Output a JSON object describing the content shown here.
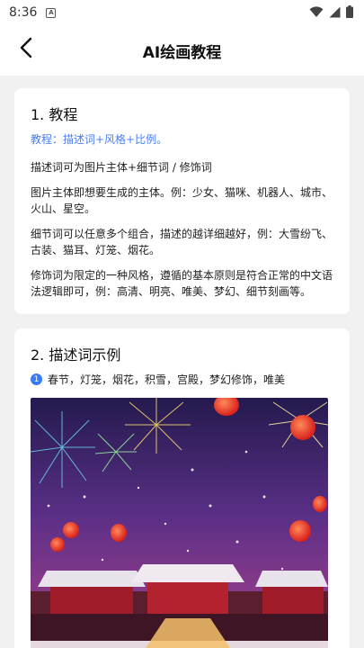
{
  "status_bar": {
    "time": "8:36",
    "app_icon_letter": "A",
    "icons": [
      "wifi-icon",
      "signal-icon",
      "battery-icon"
    ]
  },
  "header": {
    "title": "AI绘画教程",
    "back_icon": "back-arrow-icon"
  },
  "tutorial": {
    "heading": "1. 教程",
    "subtitle": "教程：描述词+风格+比例。",
    "paragraphs": [
      "描述词可为图片主体+细节词 / 修饰词",
      "图片主体即想要生成的主体。例：少女、猫咪、机器人、城市、火山、星空。",
      "细节词可以任意多个组合，描述的越详细越好，例：大雪纷飞、古装、猫耳、灯笼、烟花。",
      "修饰词为限定的一种风格，遵循的基本原则是符合正常的中文语法逻辑即可，例：高清、明亮、唯美、梦幻、细节刻画等。"
    ]
  },
  "examples": {
    "heading": "2. 描述词示例",
    "items": [
      {
        "number": "1",
        "text": "春节，灯笼，烟花，积雪，宫殿，梦幻修饰，唯美"
      }
    ]
  },
  "colors": {
    "accent": "#4a7ef7",
    "badge": "#3a7bf5",
    "page_bg": "#f1f1f1",
    "card_bg": "#ffffff"
  }
}
